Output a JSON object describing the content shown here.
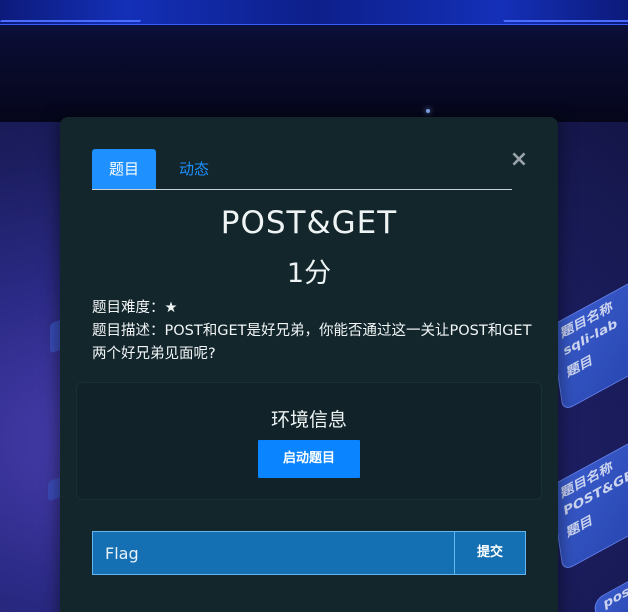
{
  "modal": {
    "tabs": [
      {
        "label": "题目",
        "active": true
      },
      {
        "label": "动态",
        "active": false
      }
    ],
    "close_icon": "×",
    "title": "POST&GET",
    "score": "1分",
    "difficulty_label": "题目难度：",
    "difficulty_value": "★",
    "description_label": "题目描述：",
    "description_text": "POST和GET是好兄弟，你能否通过这一关让POST和GET两个好兄弟见面呢?",
    "environment": {
      "title": "环境信息",
      "start_button": "启动题目"
    },
    "flag": {
      "placeholder": "Flag",
      "submit_button": "提交"
    }
  },
  "background": {
    "cards": [
      {
        "lines": [
          "题目名称",
          "sqli-lab",
          "题目"
        ]
      },
      {
        "lines": [
          "题目名称",
          "POST&GET",
          "题目"
        ]
      },
      {
        "lines": [
          "pos"
        ]
      }
    ]
  },
  "colors": {
    "accent": "#1e90ff",
    "primary_button": "#0a84ff",
    "modal_bg": "#12262c",
    "flag_bg": "#1570b3"
  }
}
